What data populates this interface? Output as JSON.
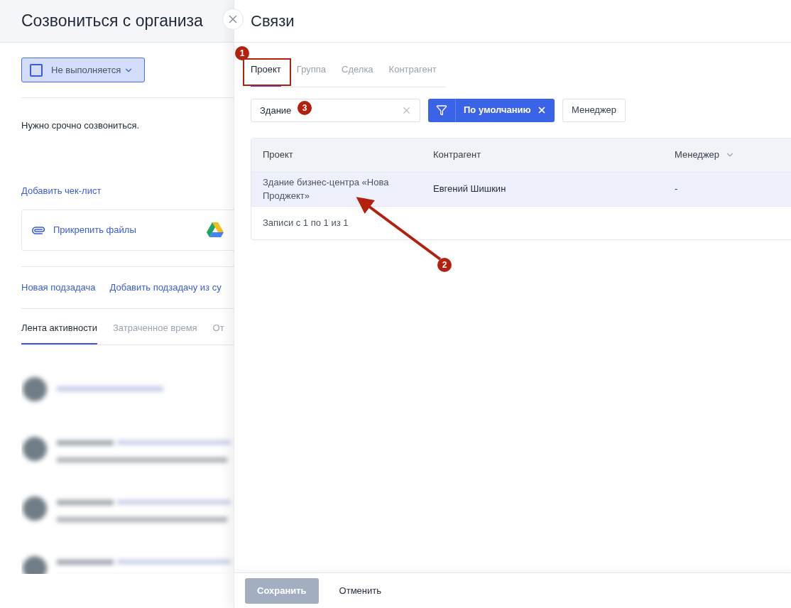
{
  "task": {
    "title": "Созвониться с организа",
    "status": {
      "label": "Не выполняется",
      "checked": false
    },
    "description": "Нужно срочно созвониться.",
    "checklist_link": "Добавить чек-лист",
    "attach_link": "Прикрепить файлы",
    "subtask_links": [
      "Новая подзадача",
      "Добавить подзадачу из су"
    ],
    "tabs": [
      {
        "label": "Лента активности",
        "selected": true
      },
      {
        "label": "Затраченное время",
        "selected": false
      },
      {
        "label": "От",
        "selected": false
      }
    ]
  },
  "panel": {
    "title": "Связи",
    "tabs": [
      {
        "label": "Проект",
        "selected": true
      },
      {
        "label": "Группа",
        "selected": false
      },
      {
        "label": "Сделка",
        "selected": false
      },
      {
        "label": "Контрагент",
        "selected": false
      }
    ],
    "search": {
      "value": "Здание"
    },
    "filter": {
      "label": "По умолчанию"
    },
    "manager_button": "Менеджер",
    "table": {
      "columns": [
        "Проект",
        "Контрагент",
        "Менеджер"
      ],
      "rows": [
        {
          "cells": [
            "Здание бизнес-центра «Нова Проджект»",
            "Евгений Шишкин",
            "-"
          ],
          "selected": true
        }
      ],
      "footer": "Записи с 1 по 1 из 1"
    },
    "buttons": [
      {
        "label": "Сохранить",
        "disabled": true
      },
      {
        "label": "Отменить",
        "disabled": false
      }
    ]
  },
  "annotations": [
    {
      "label": "1",
      "kind": "box"
    },
    {
      "label": "2",
      "kind": "arrow"
    },
    {
      "label": "3",
      "kind": "badge"
    }
  ]
}
